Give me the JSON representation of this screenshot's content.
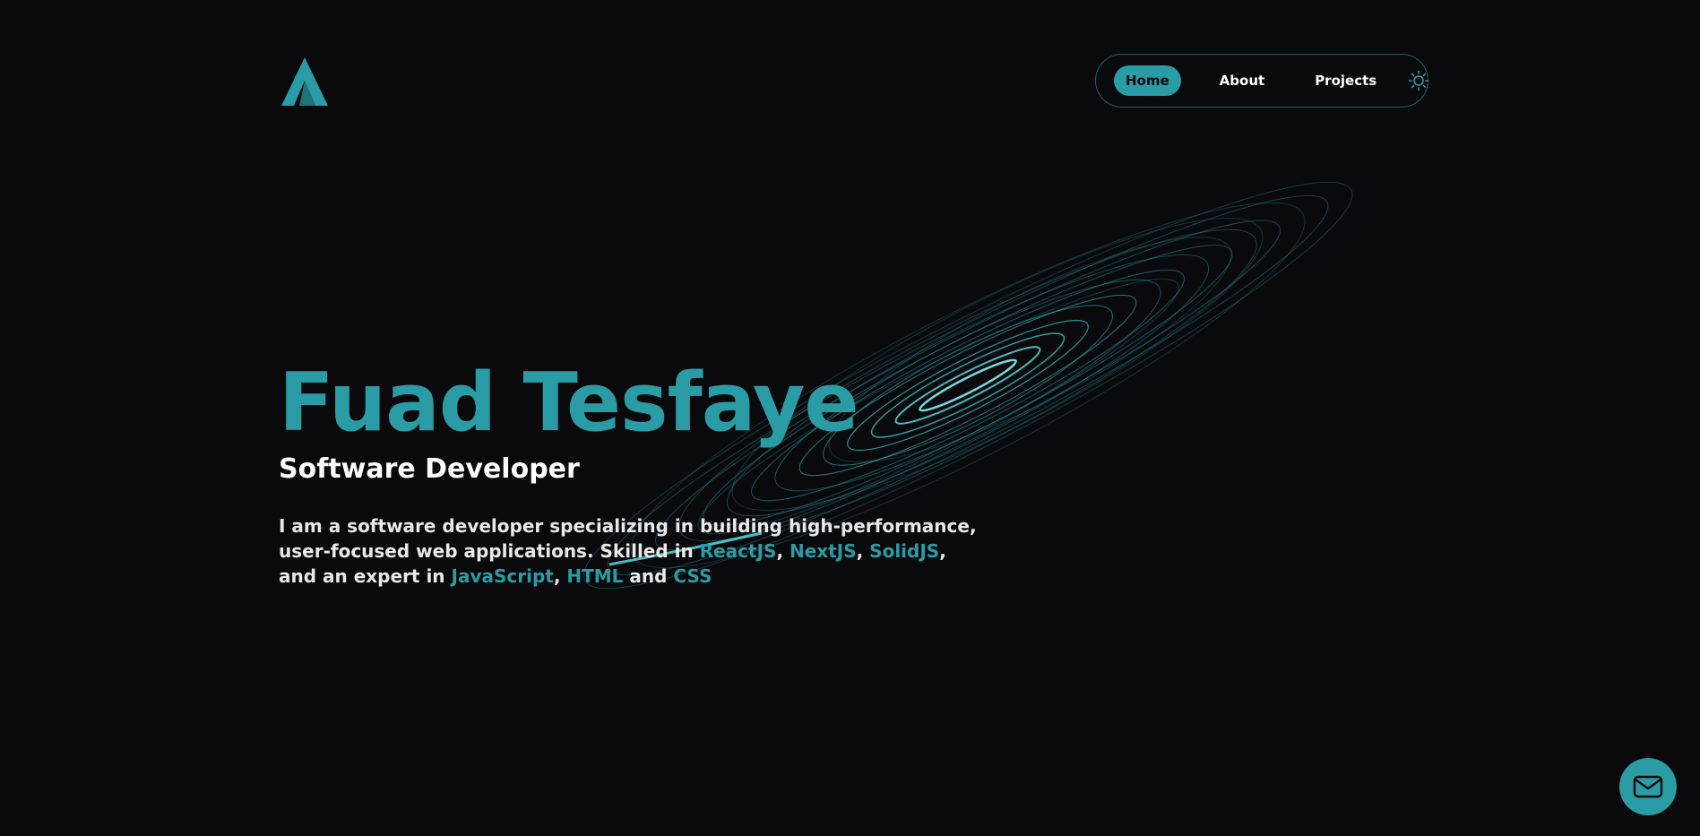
{
  "colors": {
    "accent": "#2a9ca5",
    "background": "#0a0a0c",
    "text": "#ffffff"
  },
  "header": {
    "logo_icon": "logo-a-icon",
    "nav": {
      "items": [
        {
          "label": "Home",
          "active": true
        },
        {
          "label": "About",
          "active": false
        },
        {
          "label": "Projects",
          "active": false
        }
      ],
      "theme_toggle_icon": "sun-icon"
    }
  },
  "hero": {
    "name": "Fuad Tesfaye",
    "role": "Software Developer",
    "bio": {
      "part1": "I am a software developer specializing in building high-performance, user-focused web applications. Skilled in ",
      "skill1": "ReactJS",
      "sep1": ", ",
      "skill2": "NextJS",
      "sep2": ", ",
      "skill3": "SolidJS",
      "part2": ", and an expert in ",
      "skill4": "JavaScript",
      "sep3": ", ",
      "skill5": "HTML",
      "sep4": " and ",
      "skill6": "CSS"
    }
  },
  "contact": {
    "icon": "mail-icon"
  },
  "decoration": {
    "icon": "galaxy-swirl-graphic"
  }
}
